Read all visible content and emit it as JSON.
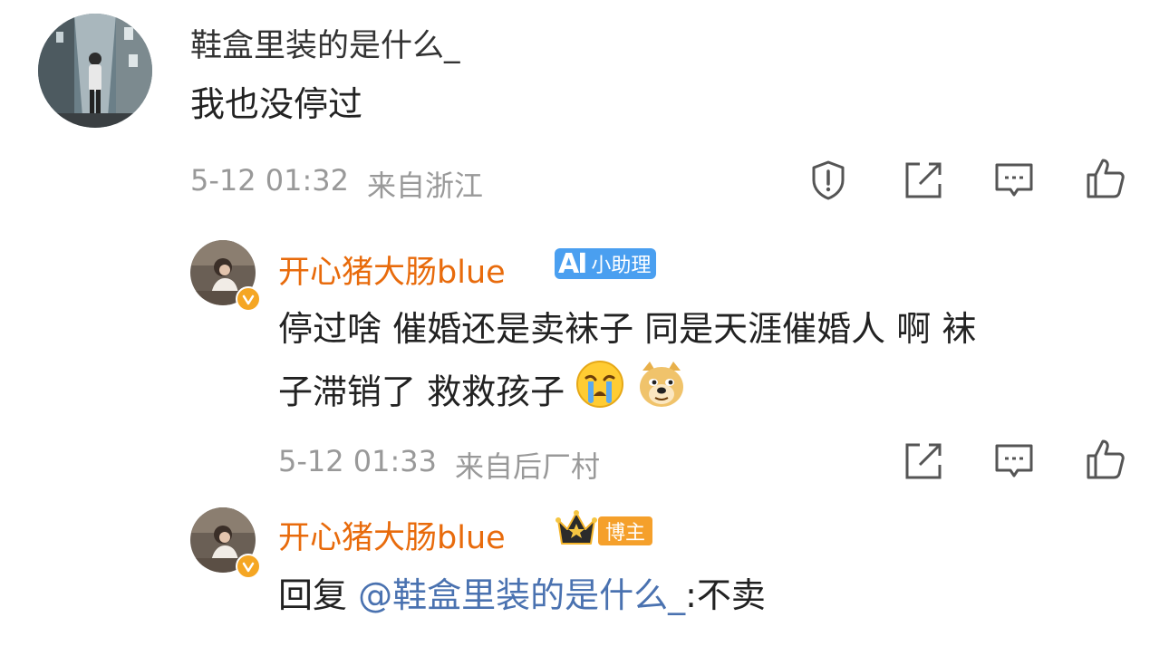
{
  "comment": {
    "username": "鞋盒里装的是什么_",
    "text": "我也没停过",
    "time": "5-12 01:32",
    "location": "来自浙江",
    "actions": [
      "report-icon",
      "repost-icon",
      "comment-icon",
      "like-icon"
    ]
  },
  "replies": [
    {
      "username": "开心猪大肠blue",
      "badge_label": "小助理",
      "badge_mark": "AI",
      "text_line1": "停过啥 催婚还是卖袜子  同是天涯催婚人 啊 袜",
      "text_line2": "子滞销了 救救孩子",
      "emojis": [
        "crying-emoji",
        "doge-emoji"
      ],
      "time": "5-12 01:33",
      "location": "来自后厂村"
    },
    {
      "username": "开心猪大肠blue",
      "badge_label": "博主",
      "reply_prefix": "回复 ",
      "reply_mention": "@鞋盒里装的是什么_",
      "reply_text": ":不卖",
      "time": "",
      "location": ""
    }
  ],
  "colors": {
    "username_orange": "#e86b0c",
    "mention_blue": "#4a72b0",
    "meta_gray": "#999999",
    "ai_badge_blue": "#4a9ff0",
    "host_badge_orange": "#f5a02b"
  }
}
